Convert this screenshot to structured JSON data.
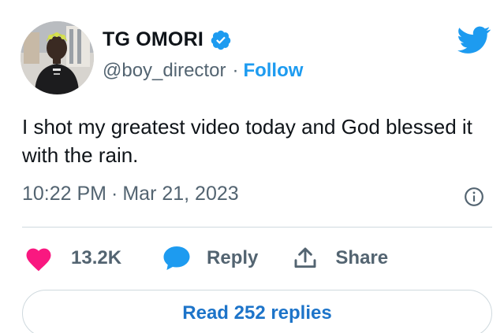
{
  "author": {
    "display_name": "TG OMORI",
    "handle": "@boy_director",
    "separator": "·",
    "follow_label": "Follow"
  },
  "tweet": {
    "text": "I shot my greatest video today and God blessed it with the rain.",
    "time": "10:22 PM",
    "separator": "·",
    "date": "Mar 21, 2023"
  },
  "actions": {
    "like_count": "13.2K",
    "reply_label": "Reply",
    "share_label": "Share"
  },
  "footer": {
    "read_replies_label": "Read 252 replies"
  },
  "icons": {
    "verified": "verified-badge-icon",
    "brand": "twitter-bird-icon",
    "info": "info-icon",
    "like": "heart-icon",
    "reply": "speech-bubble-icon",
    "share": "share-upload-icon"
  },
  "colors": {
    "brand_blue": "#1d9bf0",
    "like_pink": "#f91880",
    "text_primary": "#0f1419",
    "text_secondary": "#536471",
    "border": "#cfd9de"
  }
}
